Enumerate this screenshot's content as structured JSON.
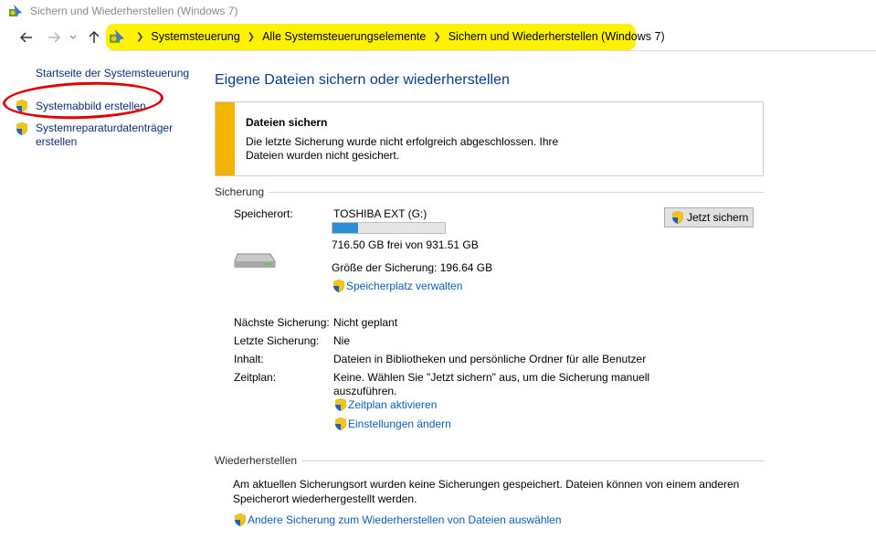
{
  "window": {
    "title": "Sichern und Wiederherstellen (Windows 7)"
  },
  "address": {
    "crumbs": [
      "Systemsteuerung",
      "Alle Systemsteuerungselemente",
      "Sichern und Wiederherstellen (Windows 7)"
    ]
  },
  "sidebar": {
    "home": "Startseite der Systemsteuerung",
    "image": "Systemabbild erstellen",
    "repair_line1": "Systemreparaturdatenträger",
    "repair_line2": "erstellen"
  },
  "main": {
    "title": "Eigene Dateien sichern oder wiederherstellen",
    "alert": {
      "title": "Dateien sichern",
      "line1": "Die letzte Sicherung wurde nicht erfolgreich abgeschlossen. Ihre",
      "line2": "Dateien wurden nicht gesichert."
    },
    "backup": {
      "heading": "Sicherung",
      "location_label": "Speicherort:",
      "location_value": "TOSHIBA EXT (G:)",
      "used_fraction": 0.23,
      "free_text": "716.50 GB frei von 931.51 GB",
      "size_text": "Größe der Sicherung: 196.64 GB",
      "manage_link": "Speicherplatz verwalten",
      "backup_now": "Jetzt sichern",
      "next_label": "Nächste Sicherung:",
      "next_value": "Nicht geplant",
      "last_label": "Letzte Sicherung:",
      "last_value": "Nie",
      "content_label": "Inhalt:",
      "content_value": "Dateien in Bibliotheken und persönliche Ordner für alle Benutzer",
      "schedule_label": "Zeitplan:",
      "schedule_line1": "Keine. Wählen Sie \"Jetzt sichern\" aus, um die Sicherung manuell",
      "schedule_line2": "auszuführen.",
      "schedule_link": "Zeitplan aktivieren",
      "settings_link": "Einstellungen ändern"
    },
    "restore": {
      "heading": "Wiederherstellen",
      "line1": "Am aktuellen Sicherungsort wurden keine Sicherungen gespeichert. Dateien können von einem anderen",
      "line2": "Speicherort wiederhergestellt werden.",
      "link": "Andere Sicherung zum Wiederherstellen von Dateien auswählen"
    }
  },
  "colors": {
    "highlight": "#fff200",
    "link": "#0a5fb5",
    "title": "#0b3b8f",
    "warning": "#f2b400",
    "annotation": "#e10000",
    "progress": "#2b8fd6"
  }
}
